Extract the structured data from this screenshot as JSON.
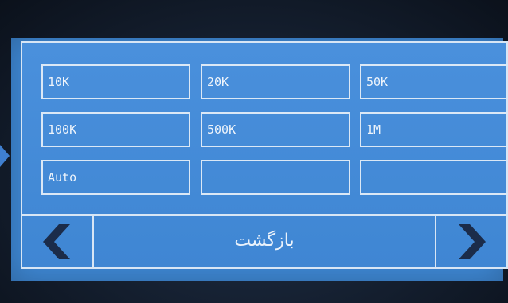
{
  "colors": {
    "screen": "#3f89d6",
    "border": "#d8e6f5",
    "text": "#eef4fb",
    "arrow": "#1b2c4a",
    "marker": "#3f7fd0"
  },
  "grid": {
    "r1c1": "10K",
    "r1c2": "20K",
    "r1c3": "50K",
    "r2c1": "100K",
    "r2c2": "500K",
    "r2c3": "1M",
    "r3c1": "Auto",
    "r3c2": "",
    "r3c3": ""
  },
  "nav": {
    "back_label": "بازگشت",
    "prev_icon": "chevron-left-icon",
    "next_icon": "chevron-right-icon"
  }
}
